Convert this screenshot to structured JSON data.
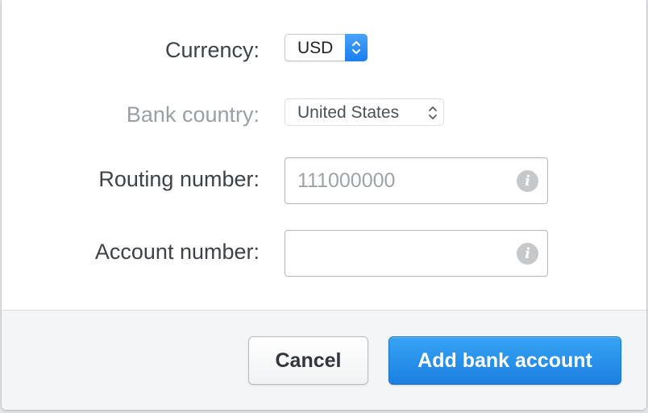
{
  "form": {
    "currency": {
      "label": "Currency:",
      "value": "USD"
    },
    "bank_country": {
      "label": "Bank country:",
      "value": "United States",
      "disabled": true
    },
    "routing_number": {
      "label": "Routing number:",
      "value": "",
      "placeholder": "111000000",
      "info_icon": "info-icon"
    },
    "account_number": {
      "label": "Account number:",
      "value": "",
      "placeholder": "",
      "info_icon": "info-icon"
    }
  },
  "footer": {
    "cancel_label": "Cancel",
    "submit_label": "Add bank account"
  },
  "colors": {
    "primary": "#1c7fe0",
    "stepper": "#2a8cf5",
    "label": "#3f4346",
    "disabled_label": "#9b9ea2"
  }
}
